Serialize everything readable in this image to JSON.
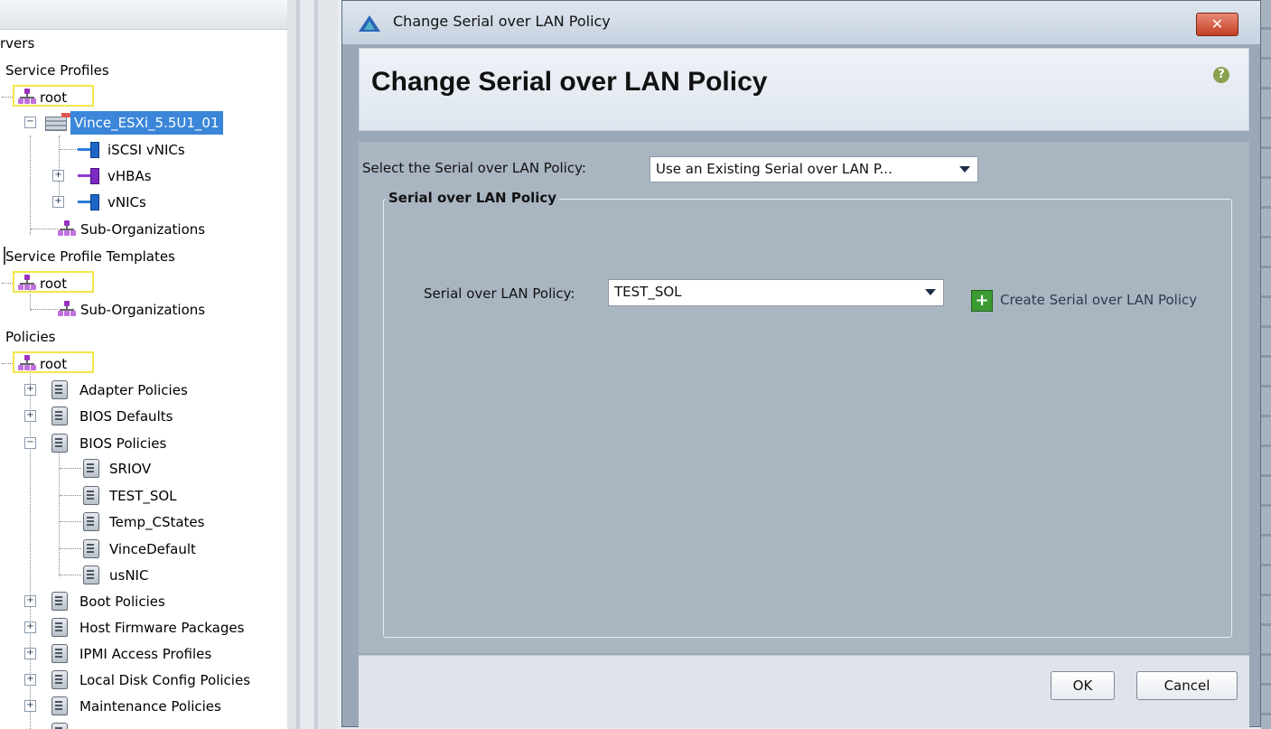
{
  "tree": {
    "header_partial": "rvers",
    "items": [
      {
        "label": "Service Profiles"
      },
      {
        "label": "root"
      },
      {
        "label": "Vince_ESXi_5.5U1_01"
      },
      {
        "label": "iSCSI vNICs"
      },
      {
        "label": "vHBAs"
      },
      {
        "label": "vNICs"
      },
      {
        "label": "Sub-Organizations"
      },
      {
        "label": "Service Profile Templates"
      },
      {
        "label": "root"
      },
      {
        "label": "Sub-Organizations"
      },
      {
        "label": "Policies"
      },
      {
        "label": "root"
      },
      {
        "label": "Adapter Policies"
      },
      {
        "label": "BIOS Defaults"
      },
      {
        "label": "BIOS Policies"
      },
      {
        "label": "SRIOV"
      },
      {
        "label": "TEST_SOL"
      },
      {
        "label": "Temp_CStates"
      },
      {
        "label": "VinceDefault"
      },
      {
        "label": "usNIC"
      },
      {
        "label": "Boot Policies"
      },
      {
        "label": "Host Firmware Packages"
      },
      {
        "label": "IPMI Access Profiles"
      },
      {
        "label": "Local Disk Config Policies"
      },
      {
        "label": "Maintenance Policies"
      }
    ]
  },
  "dialog": {
    "window_title": "Change Serial over LAN Policy",
    "close_label": "✕",
    "title": "Change Serial over LAN Policy",
    "help_label": "?",
    "select_label": "Select the Serial over LAN Policy:",
    "select_value": "Use an Existing Serial over LAN P...",
    "section_title": "Serial over LAN Policy",
    "policy_label": "Serial over LAN Policy:",
    "policy_value": "TEST_SOL",
    "create_label": "Create Serial over LAN Policy",
    "create_plus": "+",
    "ok_label": "OK",
    "cancel_label": "Cancel"
  },
  "colors": {
    "selection": "#3b86d9",
    "highlight_outline": "#f2e64a",
    "dialog_bg": "#aab5c2",
    "close_button": "#c43f24",
    "create_icon": "#3c9a32"
  }
}
